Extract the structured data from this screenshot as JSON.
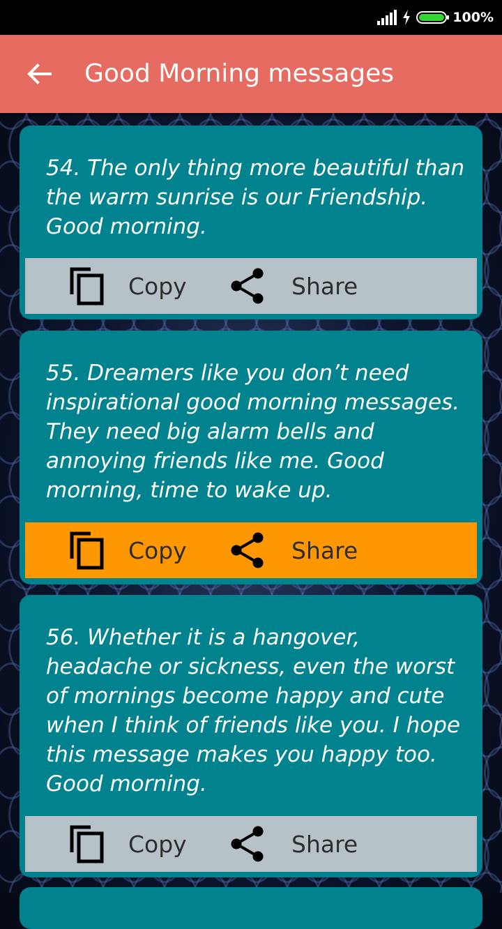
{
  "status_bar": {
    "battery": "100%"
  },
  "app_bar": {
    "title": "Good Morning messages",
    "back_icon": "arrow-back-icon"
  },
  "messages": [
    {
      "text": "54. The only thing more beautiful than the warm sunrise is our Friendship. Good morning.",
      "copy_label": "Copy",
      "share_label": "Share",
      "highlighted": false
    },
    {
      "text": "55. Dreamers like you don’t need inspirational good morning messages. They need big alarm bells and annoying friends like me. Good morning, time to wake up.",
      "copy_label": "Copy",
      "share_label": "Share",
      "highlighted": true
    },
    {
      "text": "56. Whether it is a hangover, headache or sickness, even the worst of mornings become happy and cute when I think of friends like you. I hope this message makes you happy too. Good morning.",
      "copy_label": "Copy",
      "share_label": "Share",
      "highlighted": false
    }
  ],
  "colors": {
    "app_bar": "#e66b60",
    "card": "#00838f",
    "action_bar": "#b6c2c8",
    "action_bar_active": "#ff9800",
    "battery": "#33d433"
  }
}
